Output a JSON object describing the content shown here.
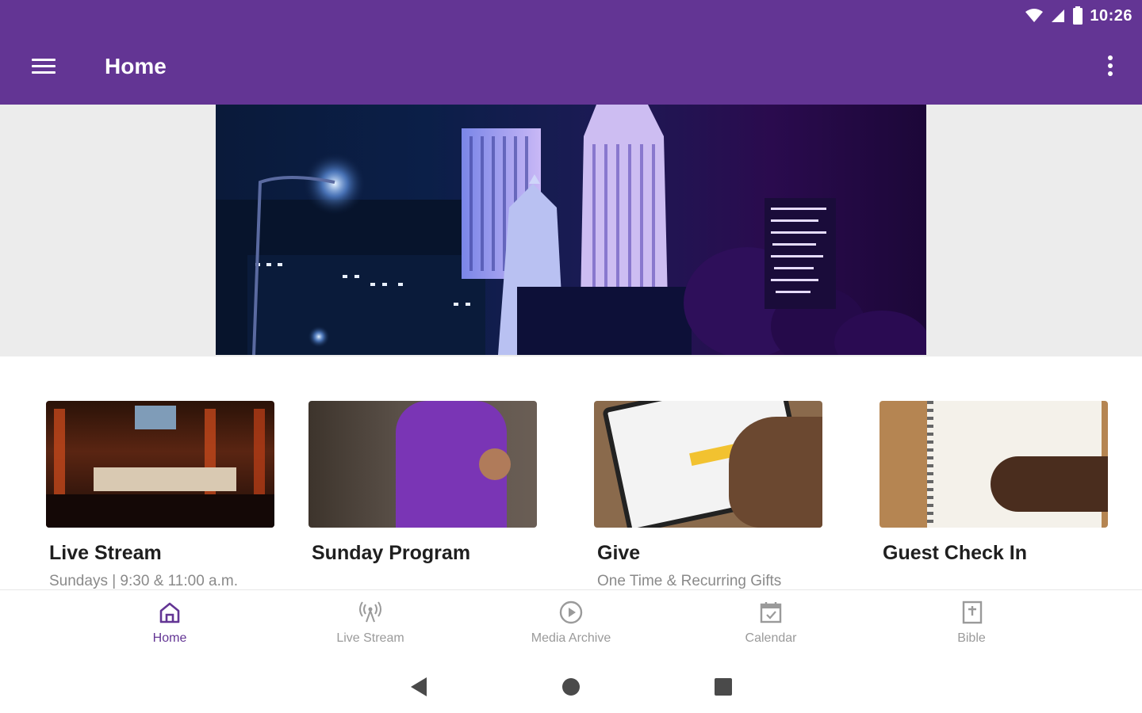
{
  "status_bar": {
    "time": "10:26"
  },
  "app_bar": {
    "title": "Home",
    "accent_color": "#633594"
  },
  "banner": {
    "alt_subject": "night city skyline"
  },
  "cards": [
    {
      "title": "Live Stream",
      "subtitle": "Sundays | 9:30 & 11:00 a.m."
    },
    {
      "title": "Sunday Program",
      "subtitle": ""
    },
    {
      "title": "Give",
      "subtitle": "One Time & Recurring Gifts"
    },
    {
      "title": "Guest Check In",
      "subtitle": ""
    }
  ],
  "bottom_nav": {
    "active_index": 0,
    "items": [
      {
        "label": "Home",
        "icon": "home-icon"
      },
      {
        "label": "Live Stream",
        "icon": "broadcast-icon"
      },
      {
        "label": "Media Archive",
        "icon": "play-circle-icon"
      },
      {
        "label": "Calendar",
        "icon": "calendar-icon"
      },
      {
        "label": "Bible",
        "icon": "bible-icon"
      }
    ]
  },
  "system_nav": {
    "buttons": [
      "back",
      "home",
      "recents"
    ]
  }
}
